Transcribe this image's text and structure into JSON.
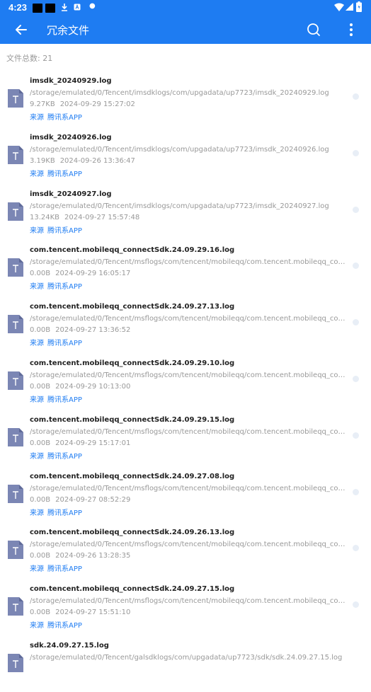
{
  "status": {
    "time": "4:23"
  },
  "appbar": {
    "title": "冗余文件"
  },
  "summary": {
    "label": "文件总数:",
    "count": "21"
  },
  "source_label": "来源",
  "files": [
    {
      "name": "imsdk_20240929.log",
      "path": "/storage/emulated/0/Tencent/imsdklogs/com/upgadata/up7723/imsdk_20240929.log",
      "size": "9.27KB",
      "time": "2024-09-29 15:27:02",
      "source": "腾讯系APP"
    },
    {
      "name": "imsdk_20240926.log",
      "path": "/storage/emulated/0/Tencent/imsdklogs/com/upgadata/up7723/imsdk_20240926.log",
      "size": "3.19KB",
      "time": "2024-09-26 13:36:47",
      "source": "腾讯系APP"
    },
    {
      "name": "imsdk_20240927.log",
      "path": "/storage/emulated/0/Tencent/imsdklogs/com/upgadata/up7723/imsdk_20240927.log",
      "size": "13.24KB",
      "time": "2024-09-27 15:57:48",
      "source": "腾讯系APP"
    },
    {
      "name": "com.tencent.mobileqq_connectSdk.24.09.29.16.log",
      "path": "/storage/emulated/0/Tencent/msflogs/com/tencent/mobileqq/com.tencent.mobileqq_connectSdk...",
      "size": "0.00B",
      "time": "2024-09-29 16:05:17",
      "source": "腾讯系APP"
    },
    {
      "name": "com.tencent.mobileqq_connectSdk.24.09.27.13.log",
      "path": "/storage/emulated/0/Tencent/msflogs/com/tencent/mobileqq/com.tencent.mobileqq_connectSdk...",
      "size": "0.00B",
      "time": "2024-09-27 13:36:52",
      "source": "腾讯系APP"
    },
    {
      "name": "com.tencent.mobileqq_connectSdk.24.09.29.10.log",
      "path": "/storage/emulated/0/Tencent/msflogs/com/tencent/mobileqq/com.tencent.mobileqq_connectSdk...",
      "size": "0.00B",
      "time": "2024-09-29 10:13:00",
      "source": "腾讯系APP"
    },
    {
      "name": "com.tencent.mobileqq_connectSdk.24.09.29.15.log",
      "path": "/storage/emulated/0/Tencent/msflogs/com/tencent/mobileqq/com.tencent.mobileqq_connectSdk...",
      "size": "0.00B",
      "time": "2024-09-29 15:17:01",
      "source": "腾讯系APP"
    },
    {
      "name": "com.tencent.mobileqq_connectSdk.24.09.27.08.log",
      "path": "/storage/emulated/0/Tencent/msflogs/com/tencent/mobileqq/com.tencent.mobileqq_connectSdk...",
      "size": "0.00B",
      "time": "2024-09-27 08:52:29",
      "source": "腾讯系APP"
    },
    {
      "name": "com.tencent.mobileqq_connectSdk.24.09.26.13.log",
      "path": "/storage/emulated/0/Tencent/msflogs/com/tencent/mobileqq/com.tencent.mobileqq_connectSdk...",
      "size": "0.00B",
      "time": "2024-09-26 13:28:35",
      "source": "腾讯系APP"
    },
    {
      "name": "com.tencent.mobileqq_connectSdk.24.09.27.15.log",
      "path": "/storage/emulated/0/Tencent/msflogs/com/tencent/mobileqq/com.tencent.mobileqq_connectSdk...",
      "size": "0.00B",
      "time": "2024-09-27 15:51:10",
      "source": "腾讯系APP"
    },
    {
      "name": "sdk.24.09.27.15.log",
      "path": "/storage/emulated/0/Tencent/galsdklogs/com/upgadata/up7723/sdk/sdk.24.09.27.15.log",
      "size": "",
      "time": "",
      "source": ""
    }
  ]
}
